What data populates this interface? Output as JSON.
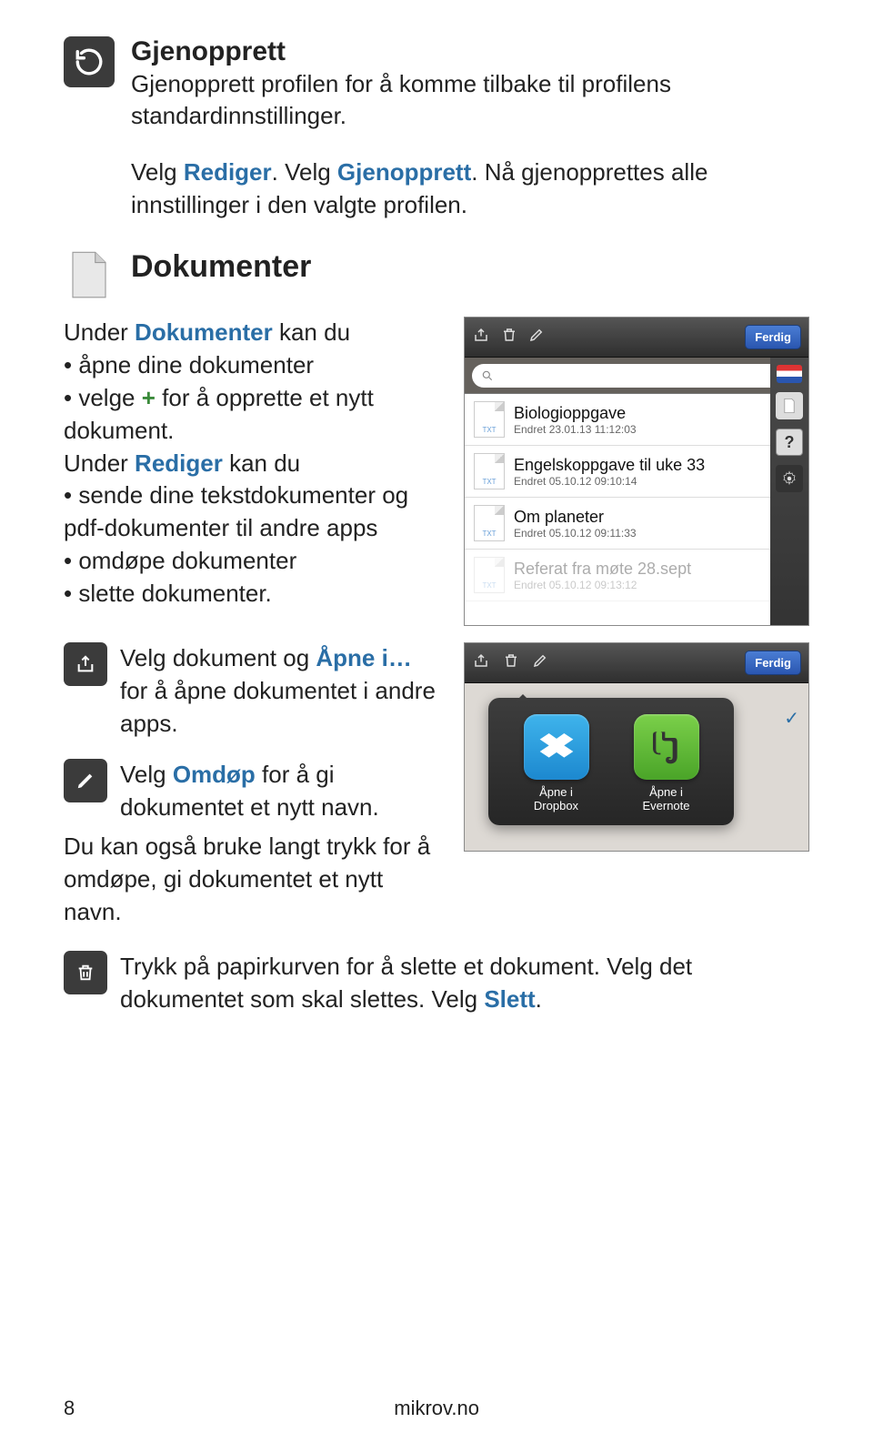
{
  "section_restore": {
    "title": "Gjenopprett",
    "body_a": "Gjenopprett profilen for å komme tilbake til profilens standardinnstillinger.",
    "body_b_pre": "Velg ",
    "body_b_kw1": "Rediger",
    "body_b_mid": ". Velg ",
    "body_b_kw2": "Gjenopprett",
    "body_b_post": ". Nå gjenopprettes alle innstillinger i den valgte profilen."
  },
  "section_docs": {
    "title": "Dokumenter",
    "intro_pre": "Under ",
    "intro_kw": "Dokumenter",
    "intro_post": " kan du",
    "bul1": "åpne dine dokumenter",
    "bul2_pre": "velge ",
    "bul2_plus": "+",
    "bul2_post": " for å opprette et nytt dokument.",
    "mid_pre": "Under ",
    "mid_kw": "Rediger",
    "mid_post": " kan du",
    "bul3": "sende dine tekstdokumenter og pdf-dokumenter til andre apps",
    "bul4": "omdøpe dokumenter",
    "bul5": "slette dokumenter."
  },
  "panel1": {
    "ferdig": "Ferdig",
    "txt_label": "TXT",
    "docs": [
      {
        "title": "Biologioppgave",
        "sub": "Endret 23.01.13 11:12:03"
      },
      {
        "title": "Engelskoppgave til uke 33",
        "sub": "Endret 05.10.12 09:10:14"
      },
      {
        "title": "Om planeter",
        "sub": "Endret 05.10.12 09:11:33"
      },
      {
        "title": "Referat fra møte 28.sept",
        "sub": "Endret 05.10.12 09:13:12"
      }
    ],
    "question_mark": "?"
  },
  "panel2": {
    "ferdig": "Ferdig",
    "apps": [
      {
        "label_a": "Åpne i",
        "label_b": "Dropbox"
      },
      {
        "label_a": "Åpne i",
        "label_b": "Evernote"
      }
    ]
  },
  "action_open": {
    "pre": "Velg dokument og ",
    "kw": "Åpne i…",
    "post": " for å åpne dokumentet i andre apps."
  },
  "action_rename": {
    "pre": "Velg ",
    "kw": "Omdøp",
    "post": " for å gi dokumentet et nytt navn.",
    "extra": "Du kan også bruke langt trykk for å omdøpe, gi dokumentet et nytt navn."
  },
  "action_delete": {
    "pre": "Trykk på papirkurven for å slette et dokument. Velg det dokumentet som skal slettes. Velg ",
    "kw": "Slett",
    "post": "."
  },
  "footer": {
    "page": "8",
    "site": "mikrov.no"
  }
}
